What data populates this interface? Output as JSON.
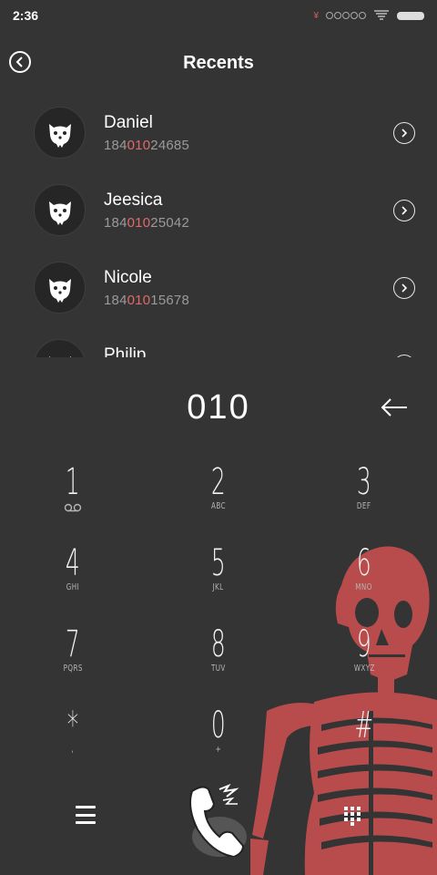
{
  "status_bar": {
    "time": "2:36",
    "notification_glyph": "¥"
  },
  "header": {
    "title": "Recents"
  },
  "recents": [
    {
      "name": "Daniel",
      "number_prefix": "184",
      "number_match": "010",
      "number_suffix": "24685"
    },
    {
      "name": "Jeesica",
      "number_prefix": "184",
      "number_match": "010",
      "number_suffix": "25042"
    },
    {
      "name": "Nicole",
      "number_prefix": "184",
      "number_match": "010",
      "number_suffix": "15678"
    },
    {
      "name": "Philip",
      "number_prefix": "",
      "number_match": "",
      "number_suffix": ""
    }
  ],
  "dial": {
    "input": "010"
  },
  "keypad": [
    {
      "digit": "1",
      "letters": ""
    },
    {
      "digit": "2",
      "letters": "ABC"
    },
    {
      "digit": "3",
      "letters": "DEF"
    },
    {
      "digit": "4",
      "letters": "GHI"
    },
    {
      "digit": "5",
      "letters": "JKL"
    },
    {
      "digit": "6",
      "letters": "MNO"
    },
    {
      "digit": "7",
      "letters": "PQRS"
    },
    {
      "digit": "8",
      "letters": "TUV"
    },
    {
      "digit": "9",
      "letters": "WXYZ"
    },
    {
      "digit": "*",
      "letters": ","
    },
    {
      "digit": "0",
      "letters": "+"
    },
    {
      "digit": "#",
      "letters": ""
    }
  ],
  "colors": {
    "background": "#343434",
    "highlight": "#e06a6a",
    "skeleton": "#b84b4b"
  },
  "icons": {
    "back": "back-circle-icon",
    "detail": "chevron-right-circle-icon",
    "backspace": "arrow-left-icon",
    "menu": "menu-icon",
    "call": "phone-call-icon",
    "keypad_toggle": "dialpad-icon"
  }
}
